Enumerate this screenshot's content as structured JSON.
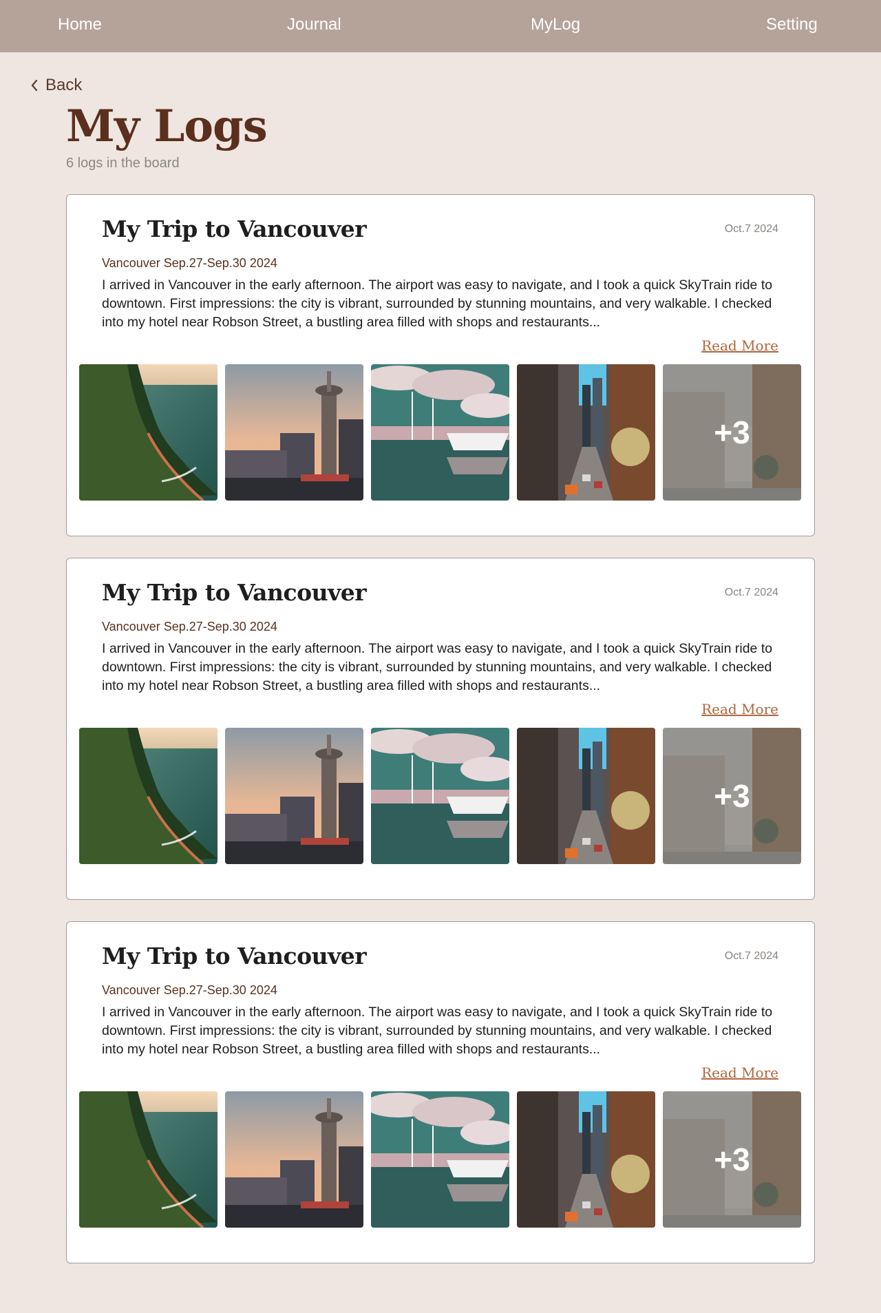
{
  "nav": {
    "items": [
      {
        "label": "Home"
      },
      {
        "label": "Journal"
      },
      {
        "label": "MyLog"
      },
      {
        "label": "Setting"
      }
    ]
  },
  "back": {
    "label": "Back",
    "icon": "chevron-left-icon"
  },
  "page": {
    "title": "My Logs",
    "subtitle": "6 logs in the board"
  },
  "logs": [
    {
      "title": "My Trip to Vancouver",
      "date": "Oct.7 2024",
      "location": "Vancouver Sep.27-Sep.30 2024",
      "excerpt": "I arrived in Vancouver in the early afternoon. The airport was easy to navigate, and I took a quick SkyTrain ride to downtown. First impressions: the city is vibrant, surrounded by stunning mountains, and very walkable. I checked into my hotel near Robson Street, a bustling area filled with shops and restaurants...",
      "read_more": "Read More",
      "more_photos": "+3"
    },
    {
      "title": "My Trip to Vancouver",
      "date": "Oct.7 2024",
      "location": "Vancouver Sep.27-Sep.30 2024",
      "excerpt": "I arrived in Vancouver in the early afternoon. The airport was easy to navigate, and I took a quick SkyTrain ride to downtown. First impressions: the city is vibrant, surrounded by stunning mountains, and very walkable. I checked into my hotel near Robson Street, a bustling area filled with shops and restaurants...",
      "read_more": "Read More",
      "more_photos": "+3"
    },
    {
      "title": "My Trip to Vancouver",
      "date": "Oct.7 2024",
      "location": "Vancouver Sep.27-Sep.30 2024",
      "excerpt": "I arrived in Vancouver in the early afternoon. The airport was easy to navigate, and I took a quick SkyTrain ride to downtown. First impressions: the city is vibrant, surrounded by stunning mountains, and very walkable. I checked into my hotel near Robson Street, a bustling area filled with shops and restaurants...",
      "read_more": "Read More",
      "more_photos": "+3"
    }
  ],
  "colors": {
    "nav_bg": "#b5a39a",
    "page_bg": "#efe6e1",
    "title_brown": "#5b2f1d",
    "link_orange": "#b0663d"
  }
}
